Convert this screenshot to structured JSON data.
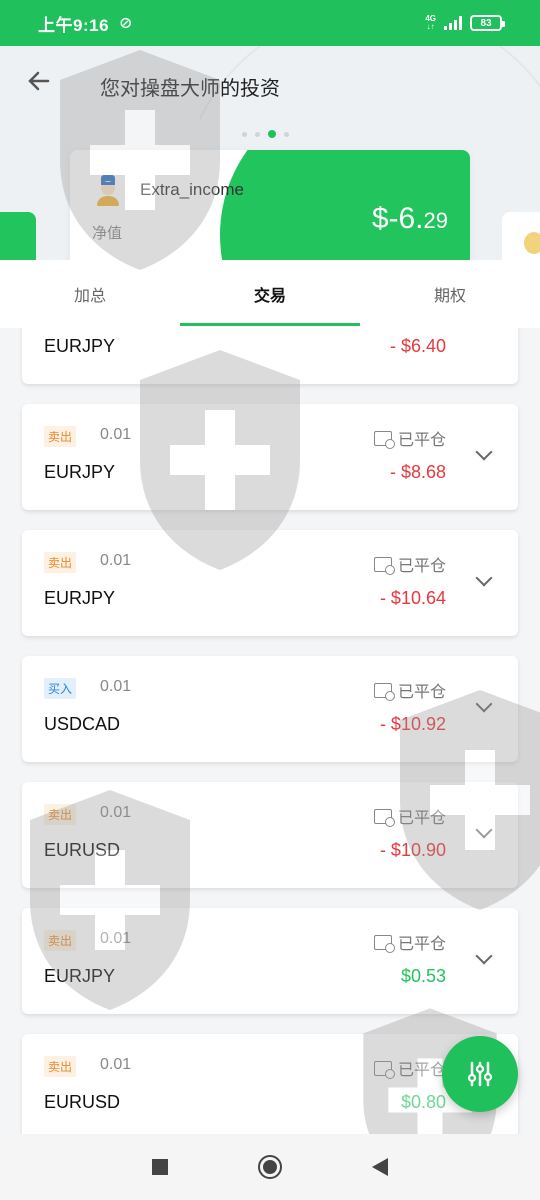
{
  "status_bar": {
    "time": "上午9:16",
    "network": "4G",
    "battery": "83"
  },
  "header": {
    "title": "您对操盘大师的投资",
    "carousel_dots": 4,
    "active_dot": 3
  },
  "card": {
    "user_name": "Extra_income",
    "nav_label": "净值",
    "amount_main": "$-6.",
    "amount_decimal": "29"
  },
  "tabs": [
    {
      "label": "加总"
    },
    {
      "label": "交易"
    },
    {
      "label": "期权"
    }
  ],
  "active_tab": 1,
  "trades": [
    {
      "side": "",
      "side_type": "sell",
      "lot": "",
      "status": "",
      "symbol": "EURJPY",
      "pnl": "- $6.40",
      "pnl_type": "neg"
    },
    {
      "side": "卖出",
      "side_type": "sell",
      "lot": "0.01",
      "status": "已平仓",
      "symbol": "EURJPY",
      "pnl": "- $8.68",
      "pnl_type": "neg"
    },
    {
      "side": "卖出",
      "side_type": "sell",
      "lot": "0.01",
      "status": "已平仓",
      "symbol": "EURJPY",
      "pnl": "- $10.64",
      "pnl_type": "neg"
    },
    {
      "side": "买入",
      "side_type": "buy",
      "lot": "0.01",
      "status": "已平仓",
      "symbol": "USDCAD",
      "pnl": "- $10.92",
      "pnl_type": "neg"
    },
    {
      "side": "卖出",
      "side_type": "sell",
      "lot": "0.01",
      "status": "已平仓",
      "symbol": "EURUSD",
      "pnl": "- $10.90",
      "pnl_type": "neg"
    },
    {
      "side": "卖出",
      "side_type": "sell",
      "lot": "0.01",
      "status": "已平仓",
      "symbol": "EURJPY",
      "pnl": "$0.53",
      "pnl_type": "pos"
    },
    {
      "side": "卖出",
      "side_type": "sell",
      "lot": "0.01",
      "status": "已平仓",
      "symbol": "EURUSD",
      "pnl": "$0.80",
      "pnl_type": "pos"
    }
  ],
  "colors": {
    "accent": "#20c05c",
    "negative": "#e8383d",
    "positive": "#22c45e",
    "sell": "#e68a2e",
    "buy": "#2a86d8"
  }
}
